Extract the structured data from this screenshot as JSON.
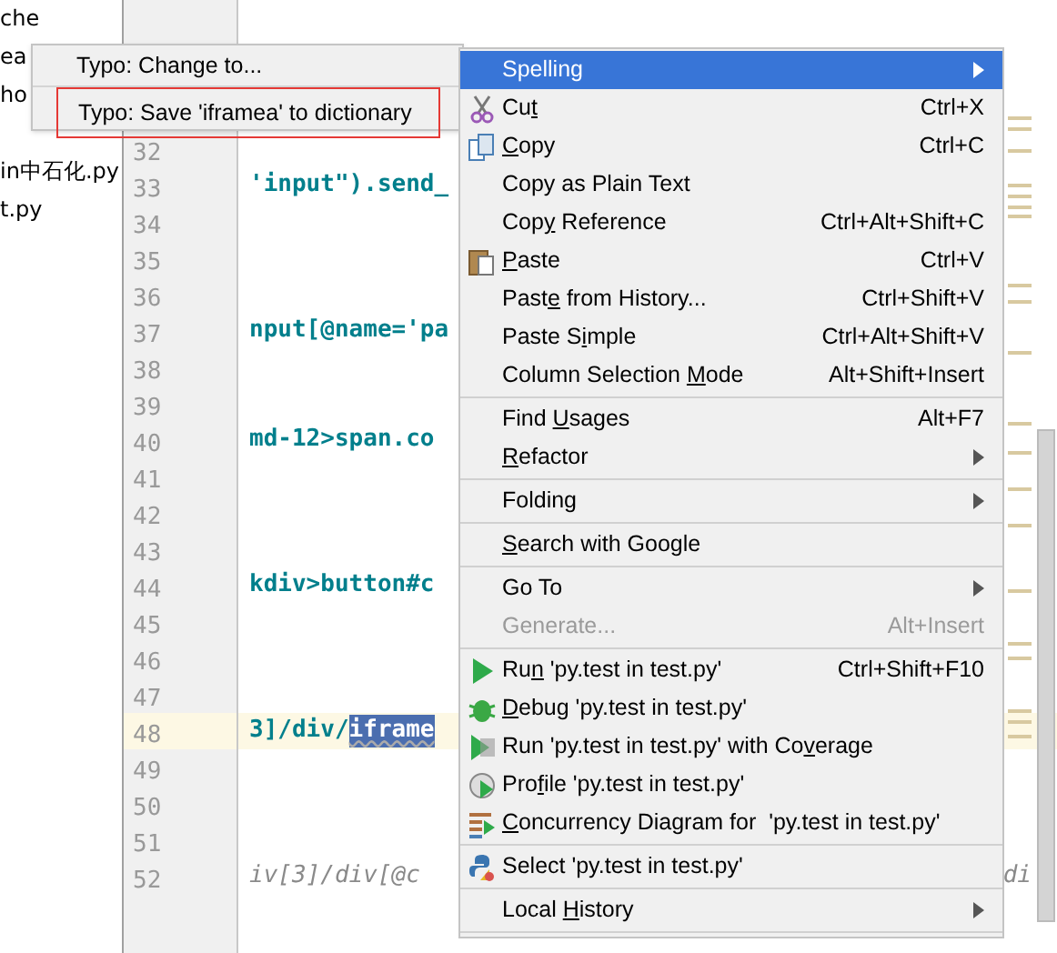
{
  "project_files": [
    {
      "name": "che"
    },
    {
      "name": "ea"
    },
    {
      "name": "ho"
    },
    {
      "name": "in中石化.py"
    },
    {
      "name": "t.py"
    }
  ],
  "code_lines": [
    {
      "number": "32",
      "current": false
    },
    {
      "number": "33",
      "text": "'input\").send_",
      "kind": "code",
      "current": false
    },
    {
      "number": "34",
      "current": false
    },
    {
      "number": "35",
      "current": false
    },
    {
      "number": "36",
      "current": false
    },
    {
      "number": "37",
      "text": "nput[@name='pa",
      "kind": "code",
      "current": false
    },
    {
      "number": "38",
      "current": false
    },
    {
      "number": "39",
      "current": false
    },
    {
      "number": "40",
      "text": "md-12>span.co",
      "kind": "code",
      "current": false
    },
    {
      "number": "41",
      "current": false
    },
    {
      "number": "42",
      "current": false
    },
    {
      "number": "43",
      "current": false
    },
    {
      "number": "44",
      "text": "kdiv>button#c",
      "kind": "code",
      "current": false
    },
    {
      "number": "45",
      "current": false
    },
    {
      "number": "46",
      "current": false
    },
    {
      "number": "47",
      "current": false
    },
    {
      "number": "48",
      "text": "3]/div/",
      "selected_text": "iframe",
      "kind": "code",
      "current": true
    },
    {
      "number": "49",
      "current": false
    },
    {
      "number": "50",
      "current": false
    },
    {
      "number": "51",
      "current": false
    },
    {
      "number": "52",
      "text": "iv[3]/div[@c",
      "text_after_menu": "di",
      "kind": "comment",
      "current": false
    }
  ],
  "submenu": [
    {
      "kind": "item",
      "label": "Typo: Change to...",
      "highlighted": false
    },
    {
      "kind": "separator"
    },
    {
      "kind": "item",
      "label": "Typo: Save 'iframea' to dictionary",
      "highlighted": true
    }
  ],
  "context_menu": [
    {
      "kind": "item",
      "label": "Spelling",
      "submenu": true,
      "selected": true,
      "disabled": false
    },
    {
      "kind": "cut",
      "label_parts": {
        "before": "Cu",
        "key": "t"
      },
      "shortcut": "Ctrl+X",
      "submenu": false,
      "selected": false,
      "disabled": false
    },
    {
      "kind": "copy",
      "label_parts": {
        "key": "C",
        "after": "opy"
      },
      "shortcut": "Ctrl+C",
      "submenu": false,
      "selected": false,
      "disabled": false
    },
    {
      "kind": "item",
      "label": "Copy as Plain Text",
      "submenu": false,
      "selected": false,
      "disabled": false
    },
    {
      "kind": "item",
      "label_parts": {
        "before": "Cop",
        "key": "y",
        "after": " Reference"
      },
      "shortcut": "Ctrl+Alt+Shift+C",
      "submenu": false,
      "selected": false,
      "disabled": false
    },
    {
      "kind": "paste",
      "label_parts": {
        "key": "P",
        "after": "aste"
      },
      "shortcut": "Ctrl+V",
      "submenu": false,
      "selected": false,
      "disabled": false
    },
    {
      "kind": "item",
      "label_parts": {
        "before": "Past",
        "key": "e",
        "after": " from History..."
      },
      "shortcut": "Ctrl+Shift+V",
      "submenu": false,
      "selected": false,
      "disabled": false
    },
    {
      "kind": "item",
      "label_parts": {
        "before": "Paste S",
        "key": "i",
        "after": "mple"
      },
      "shortcut": "Ctrl+Alt+Shift+V",
      "submenu": false,
      "selected": false,
      "disabled": false
    },
    {
      "kind": "item",
      "label_parts": {
        "before": "Column Selection ",
        "key": "M",
        "after": "ode"
      },
      "shortcut": "Alt+Shift+Insert",
      "submenu": false,
      "selected": false,
      "disabled": false
    },
    {
      "kind": "separator"
    },
    {
      "kind": "item",
      "label_parts": {
        "before": "Find ",
        "key": "U",
        "after": "sages"
      },
      "shortcut": "Alt+F7",
      "submenu": false,
      "selected": false,
      "disabled": false
    },
    {
      "kind": "item",
      "label_parts": {
        "key": "R",
        "after": "efactor"
      },
      "submenu": true,
      "selected": false,
      "disabled": false
    },
    {
      "kind": "separator"
    },
    {
      "kind": "item",
      "label": "Folding",
      "submenu": true,
      "selected": false,
      "disabled": false
    },
    {
      "kind": "separator"
    },
    {
      "kind": "item",
      "label_parts": {
        "key": "S",
        "after": "earch with Google"
      },
      "submenu": false,
      "selected": false,
      "disabled": false
    },
    {
      "kind": "separator"
    },
    {
      "kind": "item",
      "label": "Go To",
      "submenu": true,
      "selected": false,
      "disabled": false
    },
    {
      "kind": "item",
      "label": "Generate...",
      "shortcut": "Alt+Insert",
      "submenu": false,
      "selected": false,
      "disabled": true
    },
    {
      "kind": "separator"
    },
    {
      "kind": "run",
      "label_parts": {
        "before": "Ru",
        "key": "n",
        "after": " 'py.test in test.py'"
      },
      "shortcut": "Ctrl+Shift+F10",
      "submenu": false,
      "selected": false,
      "disabled": false
    },
    {
      "kind": "debug",
      "label_parts": {
        "key": "D",
        "after": "ebug 'py.test in test.py'"
      },
      "submenu": false,
      "selected": false,
      "disabled": false
    },
    {
      "kind": "coverage",
      "label_parts": {
        "before": "Run 'py.test in test.py' with Co",
        "key": "v",
        "after": "erage"
      },
      "submenu": false,
      "selected": false,
      "disabled": false
    },
    {
      "kind": "profile",
      "label_parts": {
        "before": "Pro",
        "key": "f",
        "after": "ile 'py.test in test.py'"
      },
      "submenu": false,
      "selected": false,
      "disabled": false
    },
    {
      "kind": "concurrency",
      "label_parts": {
        "key": "C",
        "after": "oncurrency Diagram for  'py.test in test.py'"
      },
      "submenu": false,
      "selected": false,
      "disabled": false
    },
    {
      "kind": "separator"
    },
    {
      "kind": "python",
      "label": "Select 'py.test in test.py'",
      "submenu": false,
      "selected": false,
      "disabled": false
    },
    {
      "kind": "separator"
    },
    {
      "kind": "item",
      "label_parts": {
        "before": "Local ",
        "key": "H",
        "after": "istory"
      },
      "submenu": true,
      "selected": false,
      "disabled": false
    },
    {
      "kind": "separator"
    }
  ]
}
